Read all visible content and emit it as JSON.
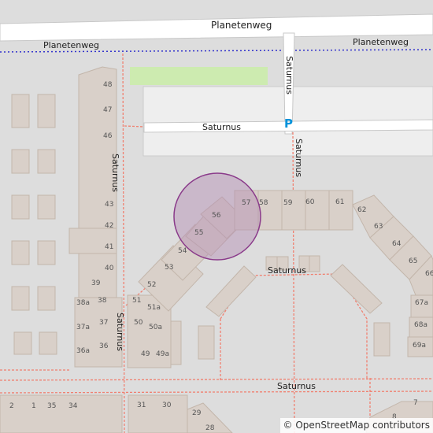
{
  "map": {
    "roads": {
      "planetenweg_top": "Planetenweg",
      "planetenweg_left": "Planetenweg",
      "planetenweg_right": "Planetenweg",
      "saturnus_mid": "Saturnus",
      "saturnus_vertical_a": "Saturnus",
      "saturnus_vertical_b": "Saturnus",
      "saturnus_left": "Saturnus",
      "saturnus_center": "Saturnus",
      "saturnus_bottom": "Saturnus",
      "saturnus_lower_left": "Saturnus"
    },
    "parking_symbol": "P",
    "house_numbers": {
      "n48": "48",
      "n47": "47",
      "n46": "46",
      "n45": "45",
      "n44": "44",
      "n43": "43",
      "n42": "42",
      "n41": "41",
      "n40": "40",
      "n39": "39",
      "n38a": "38a",
      "n38": "38",
      "n37a": "37a",
      "n37": "37",
      "n36a": "36a",
      "n36": "36",
      "n51": "51",
      "n51a": "51a",
      "n50": "50",
      "n50a": "50a",
      "n49": "49",
      "n49a": "49a",
      "n52": "52",
      "n53": "53",
      "n54": "54",
      "n55": "55",
      "n56": "56",
      "n57": "57",
      "n58": "58",
      "n59": "59",
      "n60": "60",
      "n61": "61",
      "n62": "62",
      "n63": "63",
      "n64": "64",
      "n65": "65",
      "n66": "66",
      "n67a": "67a",
      "n68a": "68a",
      "n69a": "69a",
      "n2": "2",
      "n1": "1",
      "n35": "35",
      "n34": "34",
      "n31": "31",
      "n30": "30",
      "n29": "29",
      "n28": "28",
      "n8": "8",
      "n7": "7"
    },
    "attribution": "© OpenStreetMap contributors",
    "colors": {
      "background": "#dddddd",
      "building": "#d9d0c9",
      "building_outline": "#c3b6ab",
      "road": "#ffffff",
      "road_casing": "#c8c8c8",
      "footway": "#f08070",
      "boundary": "#3333cc",
      "grass": "#cdebb0",
      "parking_area": "#eeeeee",
      "highlight_circle": "#b48cb4",
      "parking_icon": "#0092da"
    }
  }
}
